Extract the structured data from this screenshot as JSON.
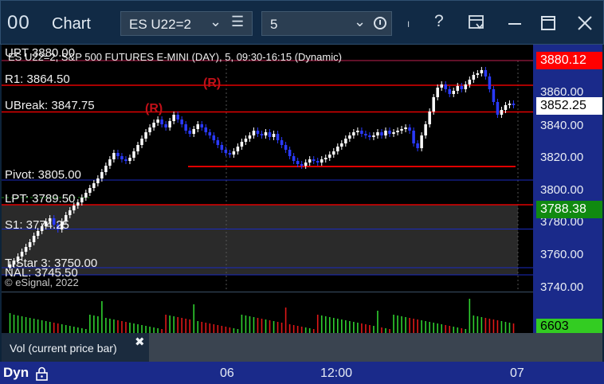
{
  "window": {
    "app_icon": "00",
    "title": "Chart",
    "symbol": "ES U22=2",
    "interval": "5",
    "toolbar_icons": [
      "chevron-down-icon",
      "hamburger-menu-icon",
      "clock-icon",
      "pin-icon",
      "help-icon",
      "settings-dropdown-icon",
      "minimize-icon",
      "maximize-icon",
      "close-icon"
    ]
  },
  "chart": {
    "header": "ES U22=2, S&P 500 FUTURES E-MINI (DAY), 5, 09:30-16:15 (Dynamic)",
    "copyright": "© eSignal, 2022",
    "levels": [
      {
        "label": "UPT 3880.00",
        "value": 3880.0,
        "color": "#c02050"
      },
      {
        "label": "R1: 3864.50",
        "value": 3864.5,
        "color": "#e00000"
      },
      {
        "label": "UBreak: 3847.75",
        "value": 3847.75,
        "color": "#e00000"
      },
      {
        "label": "Pivot: 3805.00",
        "value": 3805.0,
        "color": "#1a2ac0"
      },
      {
        "label": "LPT: 3789.50",
        "value": 3789.5,
        "color": "#e00000"
      },
      {
        "label": "S1: 3774.25",
        "value": 3774.25,
        "color": "#1a2ac0"
      },
      {
        "label": "TrStar 3: 3750.00",
        "value": 3750.0,
        "color": "#1a2ac0"
      },
      {
        "label": "NAL: 3745.50",
        "value": 3745.5,
        "color": "#1a2ac0"
      }
    ],
    "r_markers": [
      "(R)",
      "(R)"
    ],
    "price_axis": [
      "3860.00",
      "3840.00",
      "3820.00",
      "3800.00",
      "3780.00",
      "3760.00",
      "3740.00"
    ],
    "price_tags": [
      {
        "text": "3880.12",
        "bg": "#ff0000",
        "fg": "#ffffff"
      },
      {
        "text": "3852.25",
        "bg": "#ffffff",
        "fg": "#000000"
      },
      {
        "text": "3788.38",
        "bg": "#108a10",
        "fg": "#ffffff"
      }
    ],
    "volume_tag": {
      "text": "6603",
      "bg": "#33cc22",
      "fg": "#000000"
    },
    "time_axis": [
      "06",
      "12:00",
      "07"
    ],
    "study_label": "Vol (current price bar)",
    "dyn_label": "Dyn"
  },
  "chart_data": {
    "type": "candlestick",
    "ylim": [
      3735,
      3890
    ],
    "close": [
      3752,
      3754,
      3757,
      3760,
      3763,
      3766,
      3770,
      3773,
      3776,
      3779,
      3781,
      3777,
      3774,
      3779,
      3783,
      3786,
      3789,
      3791,
      3794,
      3797,
      3800,
      3803,
      3806,
      3810,
      3814,
      3818,
      3822,
      3820,
      3818,
      3817,
      3819,
      3823,
      3827,
      3831,
      3835,
      3838,
      3841,
      3843,
      3840,
      3838,
      3842,
      3846,
      3843,
      3840,
      3836,
      3834,
      3837,
      3840,
      3838,
      3835,
      3833,
      3830,
      3827,
      3824,
      3822,
      3821,
      3823,
      3826,
      3829,
      3831,
      3833,
      3836,
      3834,
      3833,
      3835,
      3832,
      3834,
      3830,
      3827,
      3824,
      3820,
      3817,
      3815,
      3814,
      3816,
      3818,
      3817,
      3816,
      3818,
      3819,
      3821,
      3823,
      3826,
      3828,
      3831,
      3833,
      3835,
      3836,
      3834,
      3833,
      3832,
      3833,
      3835,
      3833,
      3836,
      3834,
      3835,
      3836,
      3837,
      3838,
      3836,
      3828,
      3825,
      3833,
      3840,
      3848,
      3857,
      3863,
      3865,
      3862,
      3859,
      3861,
      3864,
      3862,
      3865,
      3868,
      3871,
      3872,
      3874,
      3870,
      3862,
      3854,
      3846,
      3849,
      3852,
      3853,
      3852
    ]
  }
}
